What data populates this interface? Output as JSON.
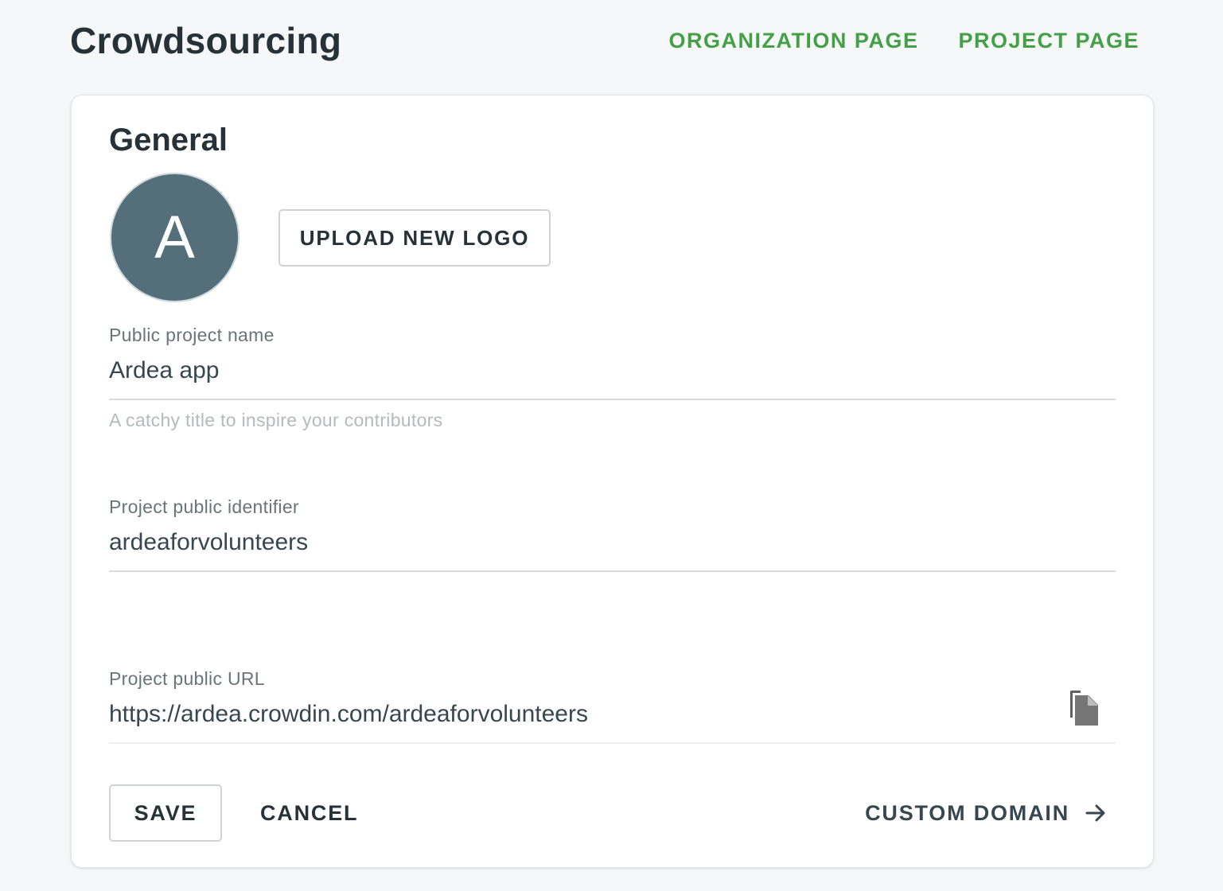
{
  "header": {
    "title": "Crowdsourcing",
    "links": [
      {
        "label": "ORGANIZATION PAGE"
      },
      {
        "label": "PROJECT PAGE"
      }
    ],
    "link_color": "#43a047"
  },
  "general": {
    "title": "General",
    "avatar_letter": "A",
    "avatar_color": "#546e7a",
    "upload_label": "UPLOAD NEW LOGO",
    "fields": [
      {
        "label": "Public project name",
        "value": "Ardea app",
        "hint": "A catchy title to inspire your contributors"
      },
      {
        "label": "Project public identifier",
        "value": "ardeaforvolunteers"
      },
      {
        "label": "Project public URL",
        "value": "https://ardea.crowdin.com/ardeaforvolunteers",
        "icon": "copy-icon"
      }
    ]
  },
  "actions": {
    "save_label": "SAVE",
    "cancel_label": "CANCEL",
    "custom_domain_label": "CUSTOM DOMAIN",
    "custom_domain_icon": "arrow-right-icon"
  }
}
